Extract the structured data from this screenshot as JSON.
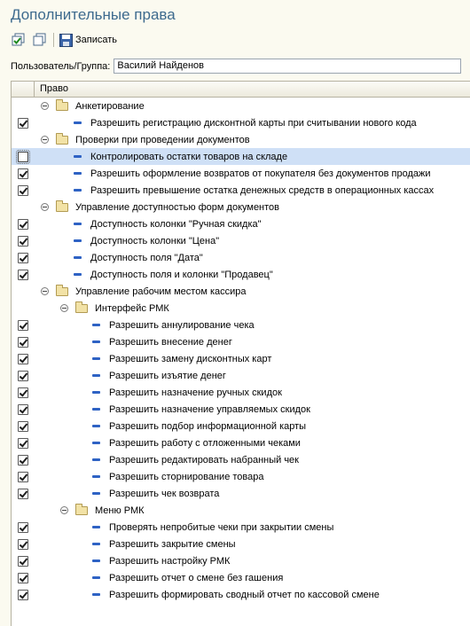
{
  "window": {
    "title": "Дополнительные права"
  },
  "toolbar": {
    "save_label": "Записать"
  },
  "user": {
    "label": "Пользователь/Группа:",
    "value": "Василий Найденов"
  },
  "grid": {
    "header": "Право",
    "rows": [
      {
        "type": "group",
        "level": 0,
        "label": "Анкетирование"
      },
      {
        "type": "item",
        "level": 1,
        "label": "Разрешить регистрацию дисконтной карты при считывании нового кода",
        "checked": true
      },
      {
        "type": "group",
        "level": 0,
        "label": "Проверки при проведении документов"
      },
      {
        "type": "item",
        "level": 1,
        "label": "Контролировать остатки товаров на складе",
        "checked": false,
        "selected": true
      },
      {
        "type": "item",
        "level": 1,
        "label": "Разрешить оформление возвратов от покупателя без документов продажи",
        "checked": true
      },
      {
        "type": "item",
        "level": 1,
        "label": "Разрешить превышение остатка денежных средств в операционных кассах",
        "checked": true
      },
      {
        "type": "group",
        "level": 0,
        "label": "Управление доступностью форм документов"
      },
      {
        "type": "item",
        "level": 1,
        "label": "Доступность колонки \"Ручная скидка\"",
        "checked": true
      },
      {
        "type": "item",
        "level": 1,
        "label": "Доступность колонки \"Цена\"",
        "checked": true
      },
      {
        "type": "item",
        "level": 1,
        "label": "Доступность поля \"Дата\"",
        "checked": true
      },
      {
        "type": "item",
        "level": 1,
        "label": "Доступность поля и колонки \"Продавец\"",
        "checked": true
      },
      {
        "type": "group",
        "level": 0,
        "label": "Управление рабочим местом кассира"
      },
      {
        "type": "group",
        "level": 1,
        "label": "Интерфейс РМК"
      },
      {
        "type": "item",
        "level": 2,
        "label": "Разрешить аннулирование чека",
        "checked": true
      },
      {
        "type": "item",
        "level": 2,
        "label": "Разрешить внесение денег",
        "checked": true
      },
      {
        "type": "item",
        "level": 2,
        "label": "Разрешить замену дисконтных карт",
        "checked": true
      },
      {
        "type": "item",
        "level": 2,
        "label": "Разрешить изъятие денег",
        "checked": true
      },
      {
        "type": "item",
        "level": 2,
        "label": "Разрешить назначение ручных скидок",
        "checked": true
      },
      {
        "type": "item",
        "level": 2,
        "label": "Разрешить назначение управляемых скидок",
        "checked": true
      },
      {
        "type": "item",
        "level": 2,
        "label": "Разрешить подбор информационной карты",
        "checked": true
      },
      {
        "type": "item",
        "level": 2,
        "label": "Разрешить работу с отложенными чеками",
        "checked": true
      },
      {
        "type": "item",
        "level": 2,
        "label": "Разрешить редактировать набранный чек",
        "checked": true
      },
      {
        "type": "item",
        "level": 2,
        "label": "Разрешить сторнирование товара",
        "checked": true
      },
      {
        "type": "item",
        "level": 2,
        "label": "Разрешить чек возврата",
        "checked": true
      },
      {
        "type": "group",
        "level": 1,
        "label": "Меню РМК"
      },
      {
        "type": "item",
        "level": 2,
        "label": "Проверять непробитые чеки при закрытии смены",
        "checked": true
      },
      {
        "type": "item",
        "level": 2,
        "label": "Разрешить закрытие смены",
        "checked": true
      },
      {
        "type": "item",
        "level": 2,
        "label": "Разрешить настройку РМК",
        "checked": true
      },
      {
        "type": "item",
        "level": 2,
        "label": "Разрешить отчет о смене без гашения",
        "checked": true
      },
      {
        "type": "item",
        "level": 2,
        "label": "Разрешить формировать сводный отчет по кассовой смене",
        "checked": true
      }
    ]
  }
}
